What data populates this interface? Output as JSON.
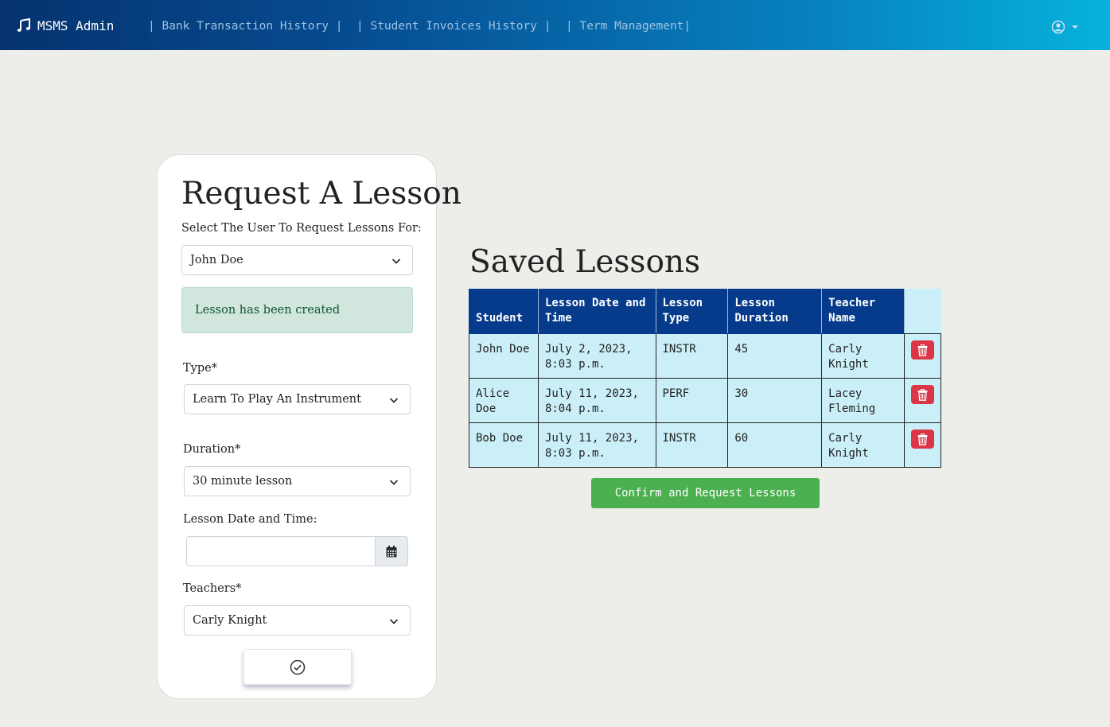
{
  "navbar": {
    "brand": "MSMS Admin",
    "links": [
      "| Bank Transaction History |",
      "| Student Invoices History |",
      "| Term Management|"
    ],
    "gradient_colors": [
      "#05336f",
      "#06b3db"
    ]
  },
  "form": {
    "title": "Request A Lesson",
    "user_label": "Select The User To Request Lessons For:",
    "user_value": "John Doe",
    "alert": "Lesson has been created",
    "type_label": "Type*",
    "type_value": "Learn To Play An Instrument",
    "duration_label": "Duration*",
    "duration_value": "30 minute lesson",
    "datetime_label": "Lesson Date and Time:",
    "datetime_value": "",
    "teachers_label": "Teachers*",
    "teachers_value": "Carly Knight"
  },
  "saved": {
    "title": "Saved Lessons",
    "columns": [
      "Student",
      "Lesson Date and Time",
      "Lesson Type",
      "Lesson Duration",
      "Teacher Name"
    ],
    "rows": [
      {
        "student": "John Doe",
        "datetime": "July 2, 2023, 8:03 p.m.",
        "type": "INSTR",
        "duration": "45",
        "teacher": "Carly Knight"
      },
      {
        "student": "Alice Doe",
        "datetime": "July 11, 2023, 8:04 p.m.",
        "type": "PERF",
        "duration": "30",
        "teacher": "Lacey Fleming"
      },
      {
        "student": "Bob Doe",
        "datetime": "July 11, 2023, 8:03 p.m.",
        "type": "INSTR",
        "duration": "60",
        "teacher": "Carly Knight"
      }
    ],
    "confirm_label": "Confirm and Request Lessons"
  },
  "icons": {
    "brand": "music-note-icon",
    "user": "user-circle-icon",
    "calendar": "calendar-icon",
    "submit": "check-circle-icon",
    "delete": "trash-icon",
    "select": "chevron-down-icon"
  },
  "colors": {
    "table_header": "#063a8a",
    "table_row": "#cbeff8",
    "confirm": "#4caf50",
    "delete": "#dc3545",
    "alert_bg": "#d1e7dd"
  }
}
